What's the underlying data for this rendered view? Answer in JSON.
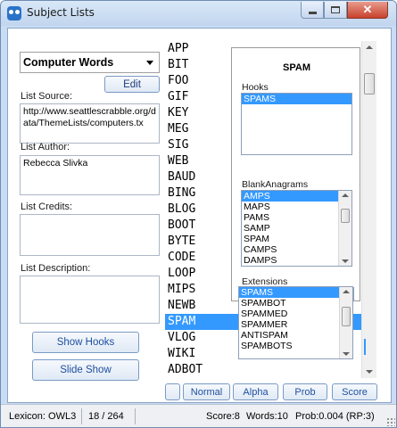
{
  "window": {
    "title": "Subject Lists"
  },
  "left_panel": {
    "list_select_value": "Computer Words",
    "edit_label": "Edit",
    "source_label": "List Source:",
    "source_value": "http://www.seattlescrabble.org/data/ThemeLists/computers.tx",
    "author_label": "List Author:",
    "author_value": "Rebecca Slivka",
    "credits_label": "List Credits:",
    "credits_value": "",
    "description_label": "List Description:",
    "description_value": "",
    "show_hooks_label": "Show Hooks",
    "slide_show_label": "Slide Show"
  },
  "word_list": {
    "items": [
      "APP",
      "BIT",
      "FOO",
      "GIF",
      "KEY",
      "MEG",
      "SIG",
      "WEB",
      "BAUD",
      "BING",
      "BLOG",
      "BOOT",
      "BYTE",
      "CODE",
      "LOOP",
      "MIPS",
      "NEWB",
      "SPAM",
      "VLOG",
      "WIKI",
      "ADBOT"
    ],
    "selected": "SPAM"
  },
  "info_panel": {
    "word": "SPAM",
    "hooks_label": "Hooks",
    "hooks": [
      "SPAMS"
    ],
    "blankanagrams_label": "BlankAnagrams",
    "blankanagrams": [
      "AMPS",
      "MAPS",
      "PAMS",
      "SAMP",
      "SPAM",
      "CAMPS",
      "DAMPS"
    ],
    "extensions_label": "Extensions",
    "extensions": [
      "SPAMS",
      "SPAMBOT",
      "SPAMMED",
      "SPAMMER",
      "ANTISPAM",
      "SPAMBOTS"
    ]
  },
  "sort_buttons": {
    "normal": "Normal",
    "alpha": "Alpha",
    "prob": "Prob",
    "score": "Score"
  },
  "status": {
    "lexicon": "Lexicon: OWL3",
    "position": "18 / 264",
    "score": "Score:8",
    "words": "Words:10",
    "prob": "Prob:0.004 (RP:3)"
  },
  "colors": {
    "selection": "#3399ff",
    "button_text": "#1e4fa0",
    "title_bar": "#c9dcf3",
    "close_button": "#c9412c"
  },
  "icons": {
    "app": "owl-icon",
    "minimize": "minimize-icon",
    "maximize": "maximize-icon",
    "close": "close-icon",
    "dropdown": "chevron-down-icon"
  }
}
